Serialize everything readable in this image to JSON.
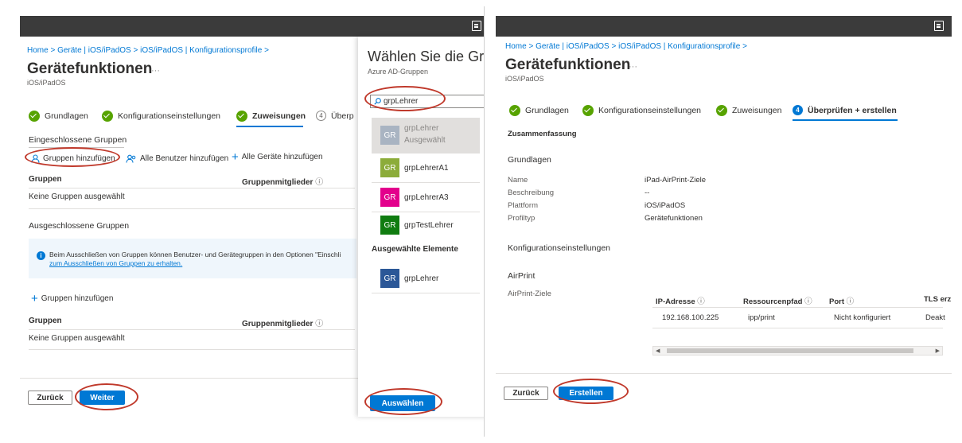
{
  "left": {
    "breadcrumb": "Home  >  Geräte | iOS/iPadOS  >  iOS/iPadOS | Konfigurationsprofile  >",
    "title": "Gerätefunktionen",
    "more": "···",
    "subtitle": "iOS/iPadOS",
    "steps": [
      {
        "label": "Grundlagen",
        "num": ""
      },
      {
        "label": "Konfigurationseinstellungen",
        "num": ""
      },
      {
        "label": "Zuweisungen",
        "num": ""
      },
      {
        "label": "Überp",
        "num": "4"
      }
    ],
    "included_heading": "Eingeschlossene Gruppen",
    "add_groups": "Gruppen hinzufügen",
    "add_all_users": "Alle Benutzer hinzufügen",
    "add_all_devices": "Alle Geräte hinzufügen",
    "col_groups": "Gruppen",
    "col_members": "Gruppenmitglieder",
    "no_groups": "Keine Gruppen ausgewählt",
    "excluded_heading": "Ausgeschlossene Gruppen",
    "info_line1": "Beim Ausschließen von Gruppen können Benutzer- und Gerätegruppen in den Optionen \"Einschli",
    "info_line2": "zum Ausschließen von Gruppen zu erhalten.",
    "add_groups_2": "Gruppen hinzufügen",
    "col_groups_2": "Gruppen",
    "col_members_2": "Gruppenmitglieder",
    "no_groups_2": "Keine Gruppen ausgewählt",
    "back": "Zurück",
    "next": "Weiter"
  },
  "picker": {
    "title": "Wählen Sie die Gr",
    "subtitle": "Azure AD-Gruppen",
    "search_value": "grpLehrer",
    "items": [
      {
        "initials": "GR",
        "name": "grpLehrer",
        "sub": "Ausgewählt",
        "color": "#a9b4c2"
      },
      {
        "initials": "GR",
        "name": "grpLehrerA1",
        "sub": "",
        "color": "#8cac3a"
      },
      {
        "initials": "GR",
        "name": "grpLehrerA3",
        "sub": "",
        "color": "#e3008c"
      },
      {
        "initials": "GR",
        "name": "grpTestLehrer",
        "sub": "",
        "color": "#107c10"
      }
    ],
    "selected_heading": "Ausgewählte Elemente",
    "selected_item": {
      "initials": "GR",
      "name": "grpLehrer",
      "color": "#2b5797"
    },
    "select_button": "Auswählen"
  },
  "right": {
    "breadcrumb": "Home  >  Geräte | iOS/iPadOS  >  iOS/iPadOS | Konfigurationsprofile  >",
    "title": "Gerätefunktionen",
    "more": "···",
    "subtitle": "iOS/iPadOS",
    "steps": [
      {
        "label": "Grundlagen",
        "num": ""
      },
      {
        "label": "Konfigurationseinstellungen",
        "num": ""
      },
      {
        "label": "Zuweisungen",
        "num": ""
      },
      {
        "label": "Überprüfen + erstellen",
        "num": "4"
      }
    ],
    "summary": "Zusammenfassung",
    "basics_heading": "Grundlagen",
    "fields": [
      {
        "label": "Name",
        "value": "iPad-AirPrint-Ziele"
      },
      {
        "label": "Beschreibung",
        "value": "--"
      },
      {
        "label": "Plattform",
        "value": "iOS/iPadOS"
      },
      {
        "label": "Profiltyp",
        "value": "Gerätefunktionen"
      }
    ],
    "config_heading": "Konfigurationseinstellungen",
    "airprint": "AirPrint",
    "airprint_targets": "AirPrint-Ziele",
    "table_headers": [
      "IP-Adresse",
      "Ressourcenpfad",
      "Port",
      "TLS erz"
    ],
    "table_row": [
      "192.168.100.225",
      "ipp/print",
      "Nicht konfiguriert",
      "Deakt"
    ],
    "back": "Zurück",
    "create": "Erstellen"
  },
  "colors": {
    "accent": "#0078d4",
    "success": "#57a300",
    "highlight": "#c0392b",
    "topbar": "#3b3b3b"
  }
}
